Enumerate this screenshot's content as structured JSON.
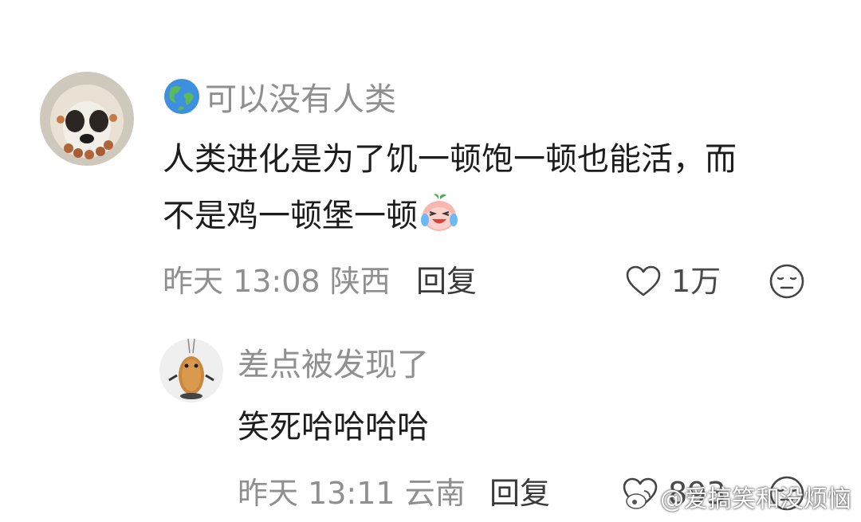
{
  "comments": [
    {
      "user": "可以没有人类",
      "user_prefix_icon": "globe-icon",
      "text_line1": "人类进化是为了饥一顿饱一顿也能活，而",
      "text_line2": "不是鸡一顿堡一顿",
      "text_emoji": "laughing-crying-peach-emoji",
      "time": "昨天 13:08",
      "location": "陕西",
      "reply_label": "回复",
      "likes": "1万"
    },
    {
      "user": "差点被发现了",
      "text": "笑死哈哈哈哈",
      "time": "昨天 13:11",
      "location": "云南",
      "reply_label": "回复",
      "likes": "893"
    }
  ],
  "watermark": "@爱搞笑和没烦恼",
  "colors": {
    "meta": "#8f8f8f",
    "text": "#1c1c1c",
    "background": "#ffffff"
  }
}
